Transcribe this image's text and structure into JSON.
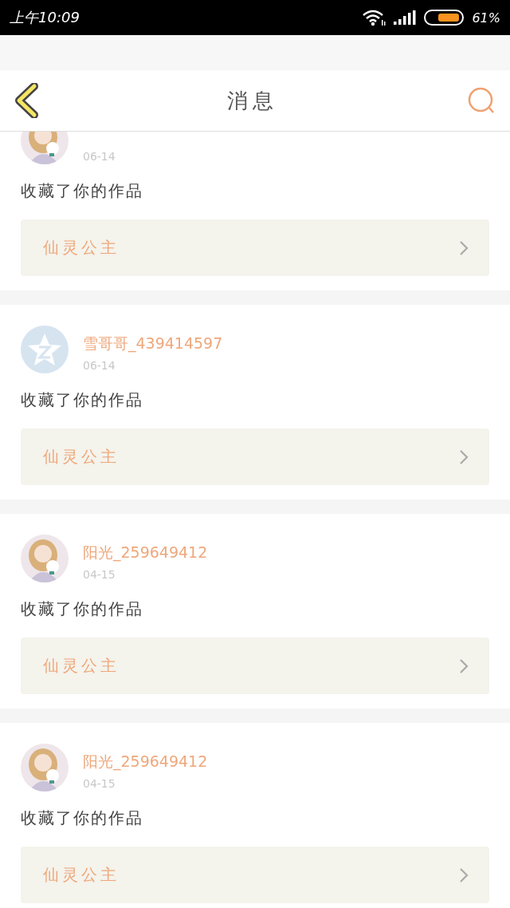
{
  "status_bar": {
    "time": "上午10:09",
    "battery": "61%"
  },
  "header": {
    "title": "消息"
  },
  "messages": [
    {
      "date": "06-14",
      "action": "收藏了你的作品",
      "work": "仙灵公主"
    },
    {
      "avatar": {
        "kind": "default"
      },
      "name": "雪哥哥_439414597",
      "date": "06-14",
      "action": "收藏了你的作品",
      "work": "仙灵公主"
    },
    {
      "name": "阳光_259649412",
      "date": "04-15",
      "action": "收藏了你的作品",
      "work": "仙灵公主"
    },
    {
      "name": "阳光_259649412",
      "date": "04-15",
      "action": "收藏了你的作品",
      "work": "仙灵公主"
    }
  ]
}
